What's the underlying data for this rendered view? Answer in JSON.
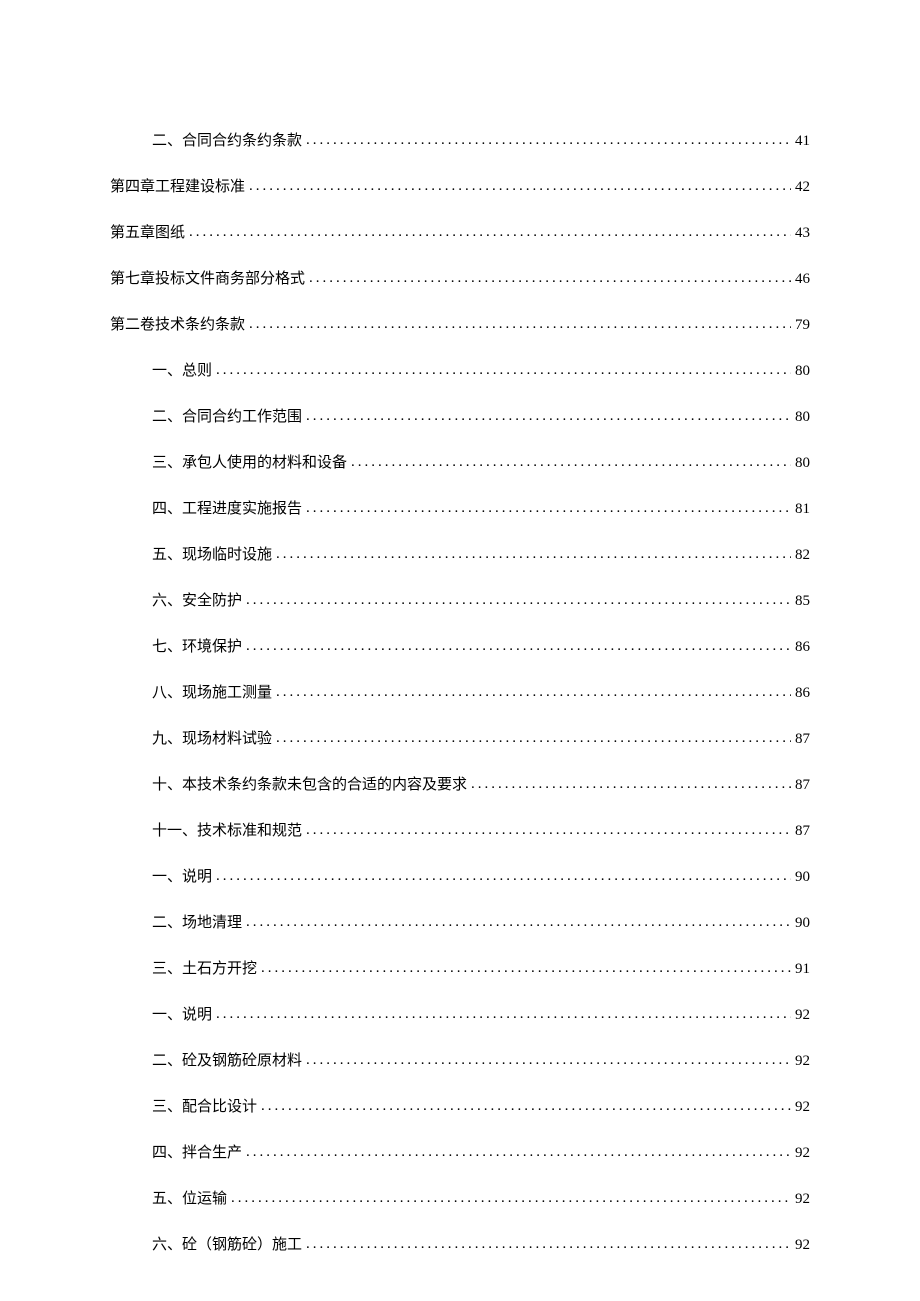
{
  "toc": [
    {
      "level": 1,
      "label": "二、合同合约条约条款",
      "page": "41"
    },
    {
      "level": 0,
      "label": "第四章工程建设标准",
      "page": "42"
    },
    {
      "level": 0,
      "label": "第五章图纸",
      "page": "43"
    },
    {
      "level": 0,
      "label": "第七章投标文件商务部分格式",
      "page": "46"
    },
    {
      "level": 0,
      "label": "第二卷技术条约条款",
      "page": "79"
    },
    {
      "level": 1,
      "label": "一、总则",
      "page": "80"
    },
    {
      "level": 1,
      "label": "二、合同合约工作范围",
      "page": "80"
    },
    {
      "level": 1,
      "label": "三、承包人使用的材料和设备",
      "page": "80"
    },
    {
      "level": 1,
      "label": "四、工程进度实施报告",
      "page": "81"
    },
    {
      "level": 1,
      "label": "五、现场临时设施",
      "page": "82"
    },
    {
      "level": 1,
      "label": "六、安全防护",
      "page": "85"
    },
    {
      "level": 1,
      "label": "七、环境保护",
      "page": "86"
    },
    {
      "level": 1,
      "label": "八、现场施工测量",
      "page": "86"
    },
    {
      "level": 1,
      "label": "九、现场材料试验",
      "page": "87"
    },
    {
      "level": 1,
      "label": "十、本技术条约条款未包含的合适的内容及要求",
      "page": "87"
    },
    {
      "level": 1,
      "label": "十一、技术标准和规范",
      "page": "87"
    },
    {
      "level": 1,
      "label": "一、说明",
      "page": "90"
    },
    {
      "level": 1,
      "label": "二、场地清理",
      "page": "90"
    },
    {
      "level": 1,
      "label": "三、土石方开挖",
      "page": "91"
    },
    {
      "level": 1,
      "label": "一、说明",
      "page": "92"
    },
    {
      "level": 1,
      "label": "二、砼及钢筋砼原材料",
      "page": "92"
    },
    {
      "level": 1,
      "label": "三、配合比设计",
      "page": "92"
    },
    {
      "level": 1,
      "label": "四、拌合生产",
      "page": "92"
    },
    {
      "level": 1,
      "label": "五、位运输",
      "page": "92"
    },
    {
      "level": 1,
      "label": "六、砼（钢筋砼）施工",
      "page": "92"
    }
  ]
}
